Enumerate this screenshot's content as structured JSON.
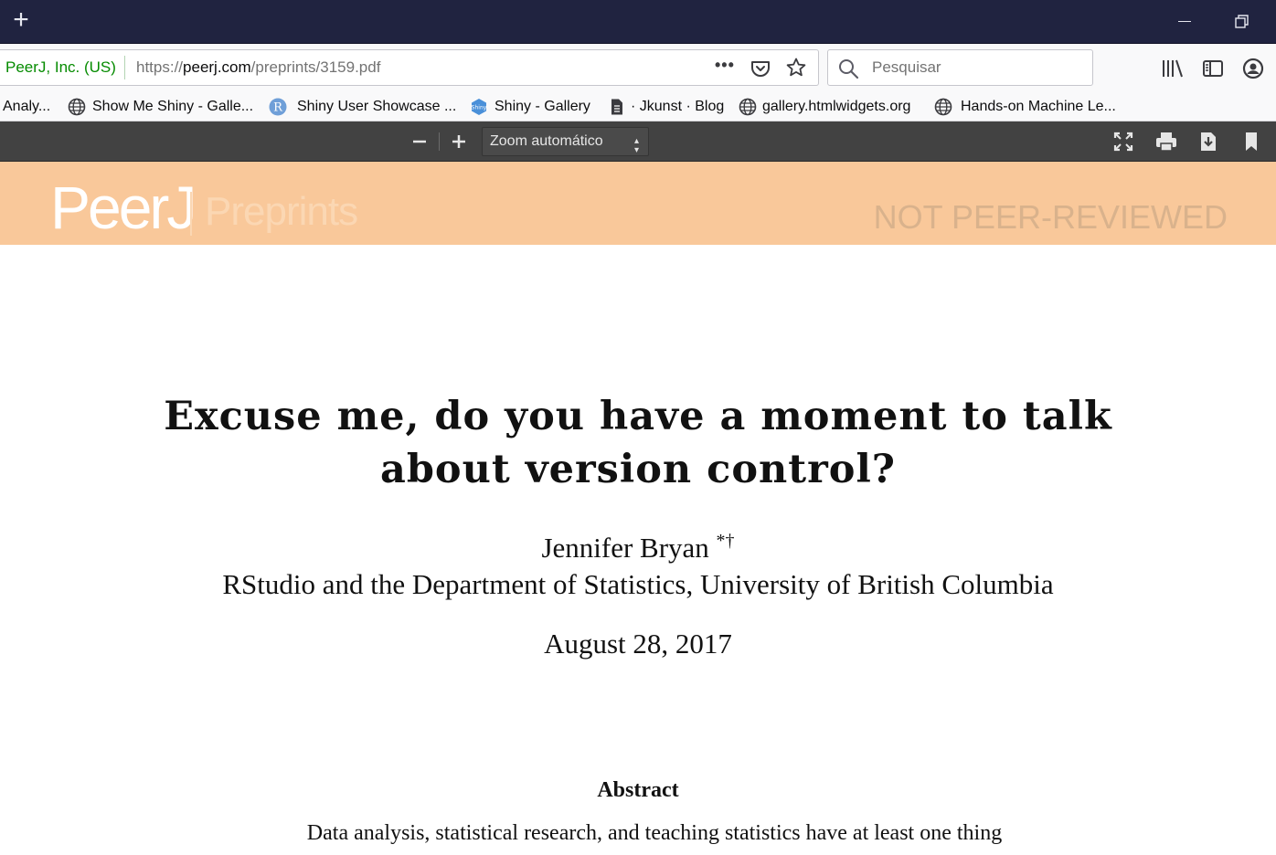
{
  "window": {
    "new_tab_label": "+"
  },
  "navbar": {
    "identity": "PeerJ, Inc. (US)",
    "url_prefix": "https://",
    "url_domain": "peerj.com",
    "url_path": "/preprints/3159.pdf",
    "page_actions": "•••",
    "search_placeholder": "Pesquisar"
  },
  "bookmarks": [
    {
      "label": "Analy...",
      "icon": ""
    },
    {
      "label": "Show Me Shiny - Galle...",
      "icon": "globe-icon"
    },
    {
      "label": "Shiny User Showcase ...",
      "icon": "r-logo-icon"
    },
    {
      "label": "Shiny - Gallery",
      "icon": "shiny-logo-icon"
    },
    {
      "label": "· Jkunst · Blog",
      "icon": "document-icon"
    },
    {
      "label": "gallery.htmlwidgets.org",
      "icon": "globe-icon"
    },
    {
      "label": "Hands-on Machine Le...",
      "icon": "globe-icon"
    }
  ],
  "pdf_toolbar": {
    "zoom": "Zoom automático"
  },
  "pdf": {
    "banner_brand": "PeerJ",
    "banner_sub": "Preprints",
    "banner_status": "NOT PEER-REVIEWED",
    "title_line1": "Excuse me, do you have a moment to talk",
    "title_line2": "about version control?",
    "author": "Jennifer Bryan",
    "author_marks": "*†",
    "affiliation": "RStudio and the Department of Statistics, University of British Columbia",
    "date": "August 28, 2017",
    "abstract_heading": "Abstract",
    "abstract_text": "Data analysis, statistical research, and teaching statistics have at least one thing"
  },
  "colors": {
    "titlebar": "#202340",
    "identity_green": "#058b00",
    "pdf_toolbar": "#424242",
    "banner": "#f9c89a"
  }
}
